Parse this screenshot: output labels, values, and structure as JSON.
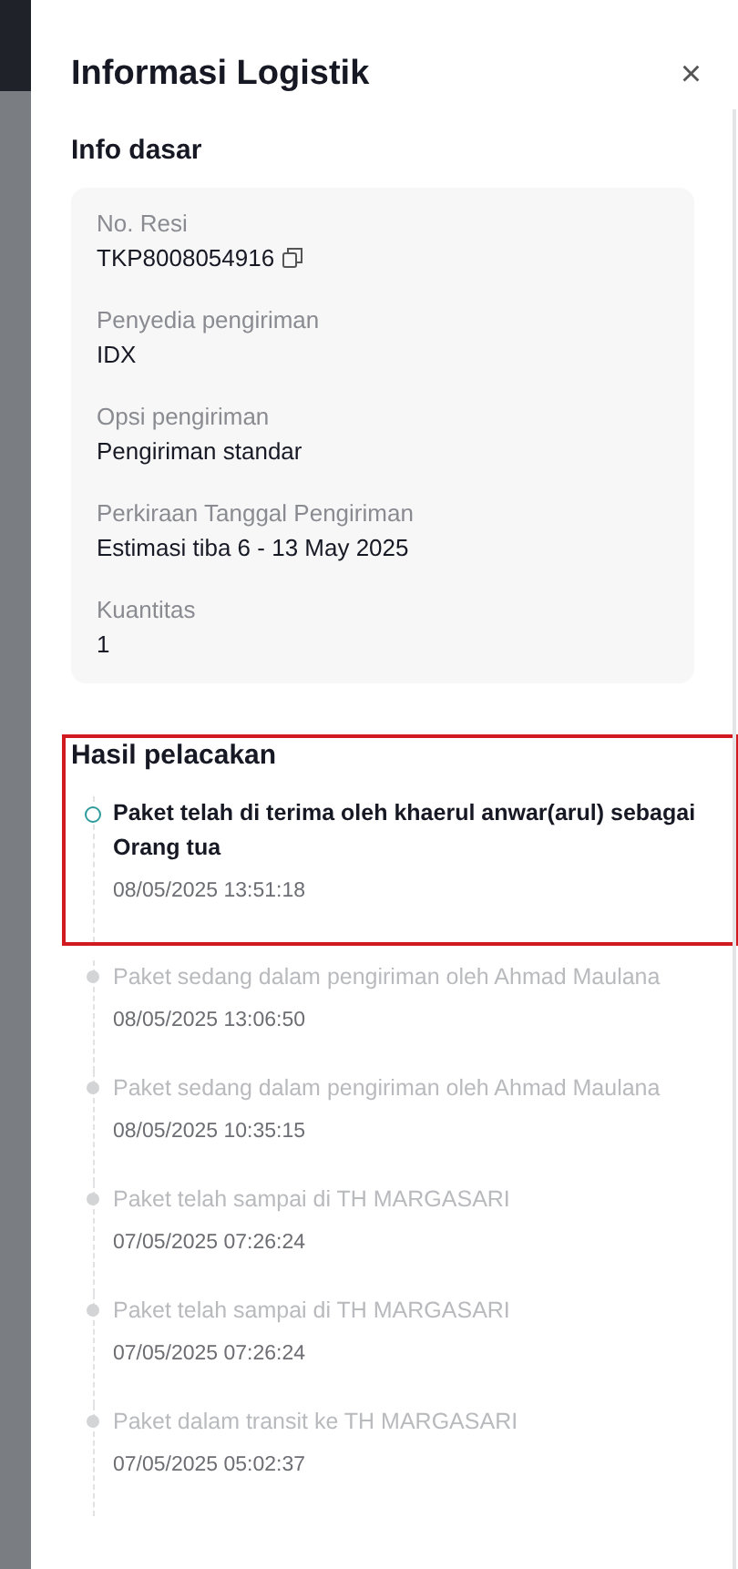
{
  "panel": {
    "title": "Informasi Logistik",
    "close": "×"
  },
  "basic_info": {
    "heading": "Info dasar",
    "fields": [
      {
        "label": "No. Resi",
        "value": "TKP8008054916",
        "copyable": true
      },
      {
        "label": "Penyedia pengiriman",
        "value": "IDX",
        "copyable": false
      },
      {
        "label": "Opsi pengiriman",
        "value": "Pengiriman standar",
        "copyable": false
      },
      {
        "label": "Perkiraan Tanggal Pengiriman",
        "value": "Estimasi tiba 6 - 13 May 2025",
        "copyable": false
      },
      {
        "label": "Kuantitas",
        "value": "1",
        "copyable": false
      }
    ]
  },
  "tracking": {
    "heading": "Hasil pelacakan",
    "highlighted": true,
    "events": [
      {
        "text": "Paket telah di terima oleh khaerul anwar(arul) sebagai Orang tua",
        "time": "08/05/2025 13:51:18",
        "current": true
      },
      {
        "text": "Paket sedang dalam pengiriman oleh Ahmad Maulana",
        "time": "08/05/2025 13:06:50",
        "current": false
      },
      {
        "text": "Paket sedang dalam pengiriman oleh Ahmad Maulana",
        "time": "08/05/2025 10:35:15",
        "current": false
      },
      {
        "text": "Paket telah sampai di TH MARGASARI",
        "time": "07/05/2025 07:26:24",
        "current": false
      },
      {
        "text": "Paket telah sampai di TH MARGASARI",
        "time": "07/05/2025 07:26:24",
        "current": false
      },
      {
        "text": "Paket dalam transit ke TH MARGASARI",
        "time": "07/05/2025 05:02:37",
        "current": false
      }
    ]
  }
}
